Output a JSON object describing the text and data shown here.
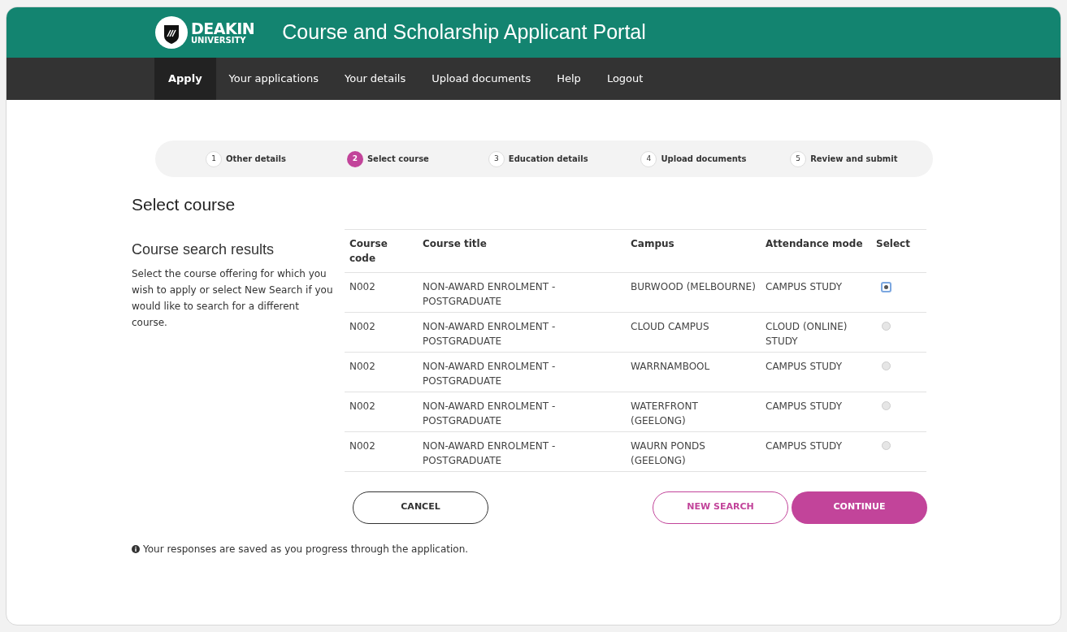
{
  "header": {
    "logo_name": "DEAKIN",
    "logo_sub": "UNIVERSITY",
    "title": "Course and Scholarship Applicant Portal"
  },
  "nav": [
    {
      "label": "Apply",
      "selected": true
    },
    {
      "label": "Your applications",
      "selected": false
    },
    {
      "label": "Your details",
      "selected": false
    },
    {
      "label": "Upload documents",
      "selected": false
    },
    {
      "label": "Help",
      "selected": false
    },
    {
      "label": "Logout",
      "selected": false
    }
  ],
  "steps": [
    {
      "number": "1",
      "label": "Other details",
      "selected": false
    },
    {
      "number": "2",
      "label": "Select course",
      "selected": true
    },
    {
      "number": "3",
      "label": "Education details",
      "selected": false
    },
    {
      "number": "4",
      "label": "Upload documents",
      "selected": false
    },
    {
      "number": "5",
      "label": "Review and submit",
      "selected": false
    }
  ],
  "page_title": "Select course",
  "side": {
    "heading": "Course search results",
    "text": "Select the course offering for which you wish to apply or select New Search if you would like to search for a different course."
  },
  "table": {
    "columns": [
      "Course code",
      "Course title",
      "Campus",
      "Attendance mode",
      "Select"
    ],
    "rows": [
      {
        "code": "N002",
        "title": "NON-AWARD ENROLMENT - POSTGRADUATE",
        "campus": "BURWOOD (MELBOURNE)",
        "mode": "CAMPUS STUDY",
        "selected": true
      },
      {
        "code": "N002",
        "title": "NON-AWARD ENROLMENT - POSTGRADUATE",
        "campus": "CLOUD CAMPUS",
        "mode": "CLOUD (ONLINE) STUDY",
        "selected": false
      },
      {
        "code": "N002",
        "title": "NON-AWARD ENROLMENT - POSTGRADUATE",
        "campus": "WARRNAMBOOL",
        "mode": "CAMPUS STUDY",
        "selected": false
      },
      {
        "code": "N002",
        "title": "NON-AWARD ENROLMENT - POSTGRADUATE",
        "campus": "WATERFRONT (GEELONG)",
        "mode": "CAMPUS STUDY",
        "selected": false
      },
      {
        "code": "N002",
        "title": "NON-AWARD ENROLMENT - POSTGRADUATE",
        "campus": "WAURN PONDS (GEELONG)",
        "mode": "CAMPUS STUDY",
        "selected": false
      }
    ]
  },
  "buttons": {
    "cancel": "CANCEL",
    "new_search": "NEW SEARCH",
    "continue": "CONTINUE"
  },
  "note": "Your responses are saved as you progress through the application."
}
